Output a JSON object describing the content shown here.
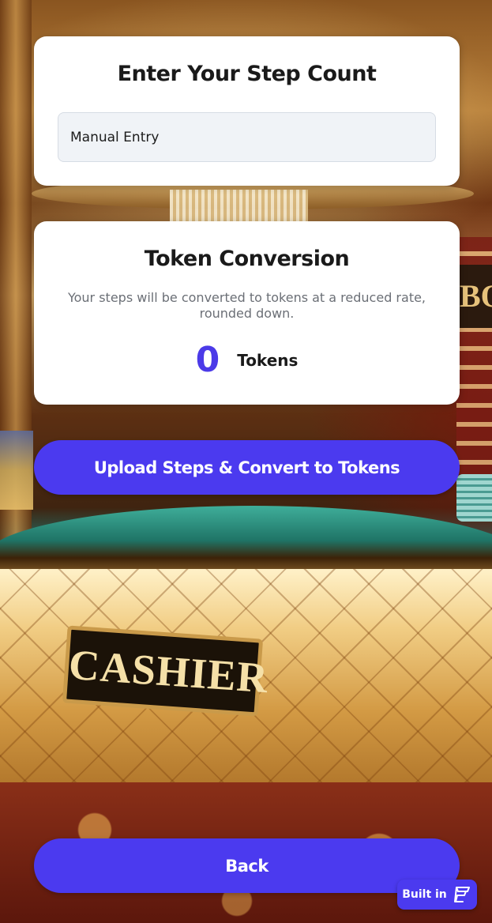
{
  "steps_card": {
    "title": "Enter Your Step Count",
    "input_placeholder": "Manual Entry",
    "input_value": ""
  },
  "token_card": {
    "title": "Token Conversion",
    "description": "Your steps will be converted to tokens at a reduced rate, rounded down.",
    "token_count": "0",
    "token_label": "Tokens"
  },
  "actions": {
    "upload_label": "Upload Steps & Convert to Tokens",
    "back_label": "Back"
  },
  "badge": {
    "label": "Built in",
    "icon": "builder-logo-icon"
  },
  "background": {
    "sign_text": "CASHIER",
    "partial_sign_text": "BO"
  },
  "colors": {
    "accent": "#4b3aef",
    "token_number": "#4b3ae8",
    "card_bg": "#ffffff",
    "input_bg": "#f0f3f7"
  }
}
